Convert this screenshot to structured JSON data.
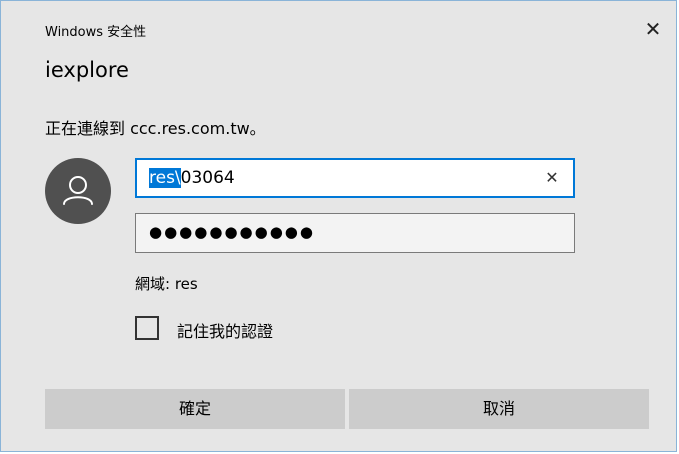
{
  "dialog": {
    "security_title": "Windows 安全性",
    "app_title": "iexplore",
    "message": "正在連線到 ccc.res.com.tw。",
    "close_glyph": "✕"
  },
  "credentials": {
    "username_selected": "res\\",
    "username_rest": "03064",
    "clear_glyph": "✕",
    "password_mask": "●●●●●●●●●●●",
    "domain_text": "網域: res"
  },
  "remember": {
    "label": "記住我的認證",
    "checked": false
  },
  "buttons": {
    "ok_label": "確定",
    "cancel_label": "取消"
  },
  "icons": {
    "avatar": "user-icon",
    "close": "close-icon",
    "clear": "clear-icon"
  },
  "colors": {
    "accent": "#0078d7",
    "background": "#e6e6e6",
    "avatar_bg": "#505050",
    "button_bg": "#cccccc"
  }
}
